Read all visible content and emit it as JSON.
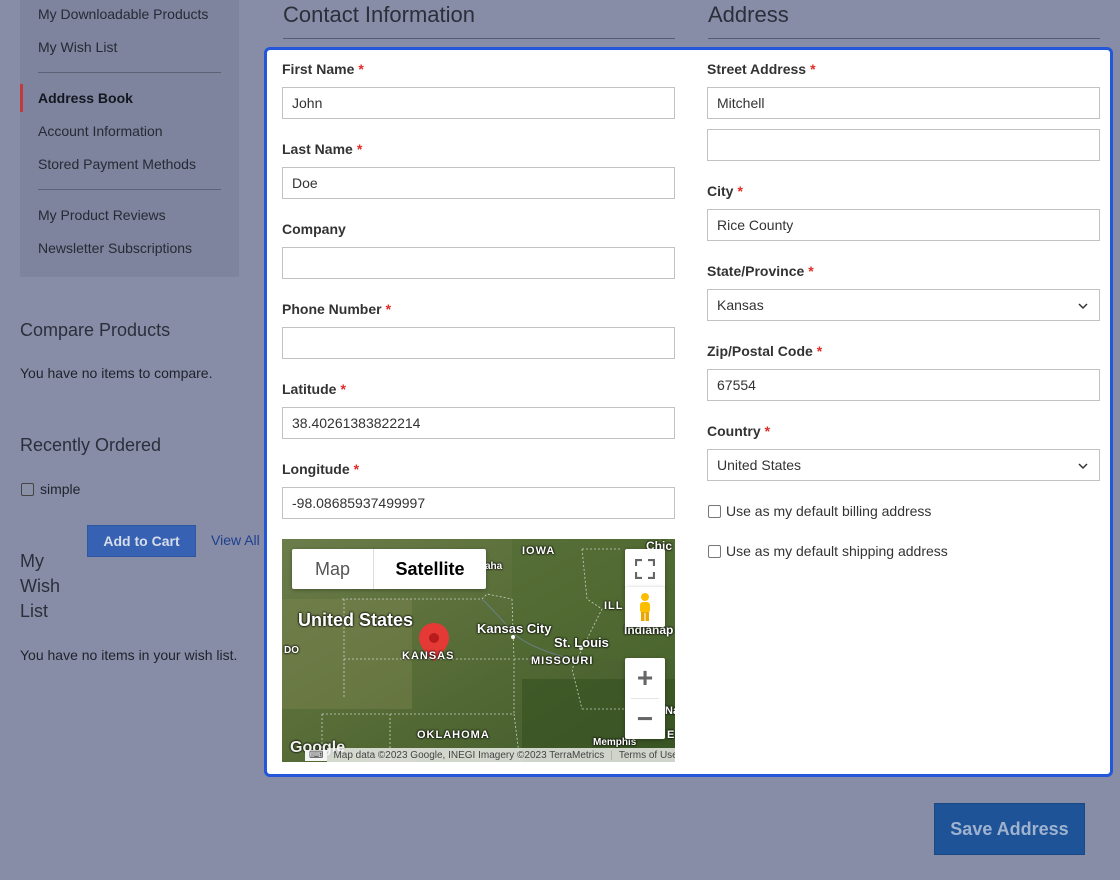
{
  "sidebar": {
    "nav": {
      "downloadable": "My Downloadable Products",
      "wishlist": "My Wish List",
      "address_book": "Address Book",
      "account_info": "Account Information",
      "payment_methods": "Stored Payment Methods",
      "reviews": "My Product Reviews",
      "newsletter": "Newsletter Subscriptions"
    },
    "compare": {
      "title": "Compare Products",
      "empty": "You have no items to compare."
    },
    "recent": {
      "title": "Recently Ordered",
      "item": "simple",
      "add_to_cart": "Add to Cart",
      "view_all": "View All"
    },
    "wish": {
      "title_l1": "My",
      "title_l2": "Wish",
      "title_l3": "List",
      "empty": "You have no items in your wish list."
    }
  },
  "contact": {
    "title": "Contact Information",
    "first_name": {
      "label": "First Name",
      "value": "John"
    },
    "last_name": {
      "label": "Last Name",
      "value": "Doe"
    },
    "company": {
      "label": "Company",
      "value": ""
    },
    "phone": {
      "label": "Phone Number",
      "value": ""
    },
    "latitude": {
      "label": "Latitude",
      "value": "38.40261383822214"
    },
    "longitude": {
      "label": "Longitude",
      "value": "-98.08685937499997"
    }
  },
  "address": {
    "title": "Address",
    "street": {
      "label": "Street Address",
      "value": "Mitchell",
      "value2": ""
    },
    "city": {
      "label": "City",
      "value": "Rice County"
    },
    "state": {
      "label": "State/Province",
      "value": "Kansas"
    },
    "zip": {
      "label": "Zip/Postal Code",
      "value": "67554"
    },
    "country": {
      "label": "Country",
      "value": "United States"
    },
    "default_billing": "Use as my default billing address",
    "default_shipping": "Use as my default shipping address"
  },
  "required_mark": "*",
  "map": {
    "map_btn": "Map",
    "satellite_btn": "Satellite",
    "labels": {
      "us": "United States",
      "kansas": "KANSAS",
      "kansas_city": "Kansas City",
      "st_louis": "St. Louis",
      "missouri": "MISSOURI",
      "iowa": "IOWA",
      "oklahoma": "OKLAHOMA",
      "memphis": "Memphis",
      "chic": "Chic",
      "ill": "ILL",
      "indianap": "Indianap",
      "aha": "aha",
      "do": "DO",
      "na": "Na",
      "e": "E",
      "google": "Google"
    },
    "attribution": "Map data ©2023 Google, INEGI Imagery ©2023 TerraMetrics",
    "terms": "Terms of Use",
    "zoom_in": "+",
    "zoom_out": "−"
  },
  "save_button": "Save Address",
  "colors": {
    "accent": "#2456d9",
    "required": "#e02b27",
    "pin": "#e53935"
  }
}
